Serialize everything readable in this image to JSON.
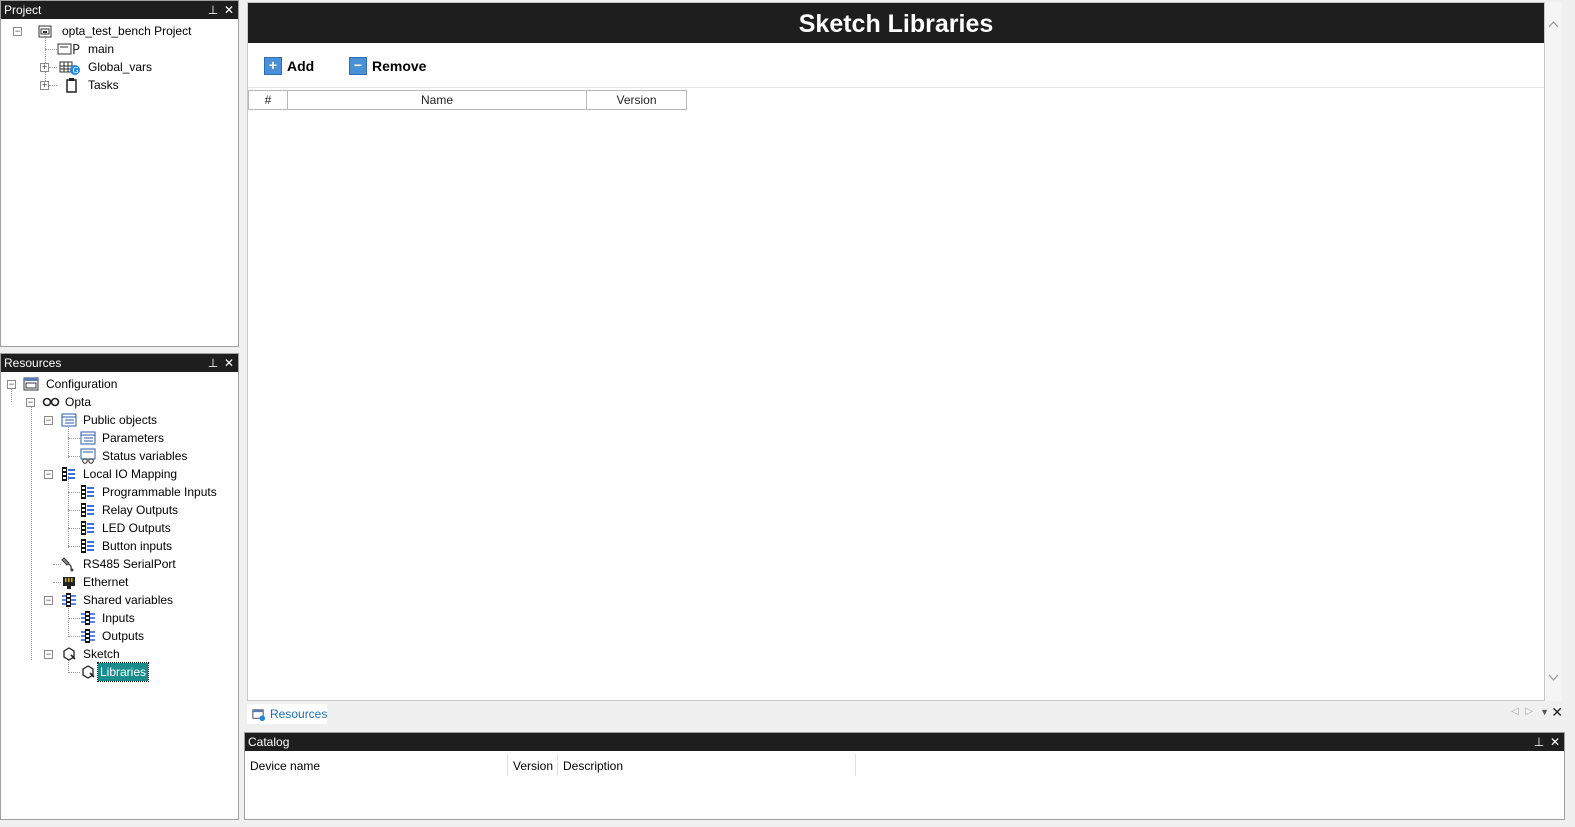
{
  "project_panel": {
    "title": "Project",
    "tree": {
      "root": "opta_test_bench Project",
      "items": [
        "main",
        "Global_vars",
        "Tasks"
      ]
    }
  },
  "resources_panel": {
    "title": "Resources",
    "tree": {
      "configuration": "Configuration",
      "opta": "Opta",
      "public_objects": "Public objects",
      "parameters": "Parameters",
      "status_variables": "Status variables",
      "local_io_mapping": "Local IO Mapping",
      "programmable_inputs": "Programmable Inputs",
      "relay_outputs": "Relay Outputs",
      "led_outputs": "LED Outputs",
      "button_inputs": "Button inputs",
      "rs485": "RS485 SerialPort",
      "ethernet": "Ethernet",
      "shared_variables": "Shared variables",
      "inputs": "Inputs",
      "outputs": "Outputs",
      "sketch": "Sketch",
      "libraries": "Libraries"
    }
  },
  "document": {
    "title": "Sketch Libraries",
    "toolbar": {
      "add_label": "Add",
      "remove_label": "Remove"
    },
    "table": {
      "columns": [
        "#",
        "Name",
        "Version"
      ],
      "rows": []
    }
  },
  "bottom_tab": {
    "label": "Resources"
  },
  "catalog_panel": {
    "title": "Catalog",
    "columns": [
      "Device name",
      "Version",
      "Description"
    ]
  },
  "icons": {
    "pin": "pin-icon",
    "close": "close-icon"
  }
}
